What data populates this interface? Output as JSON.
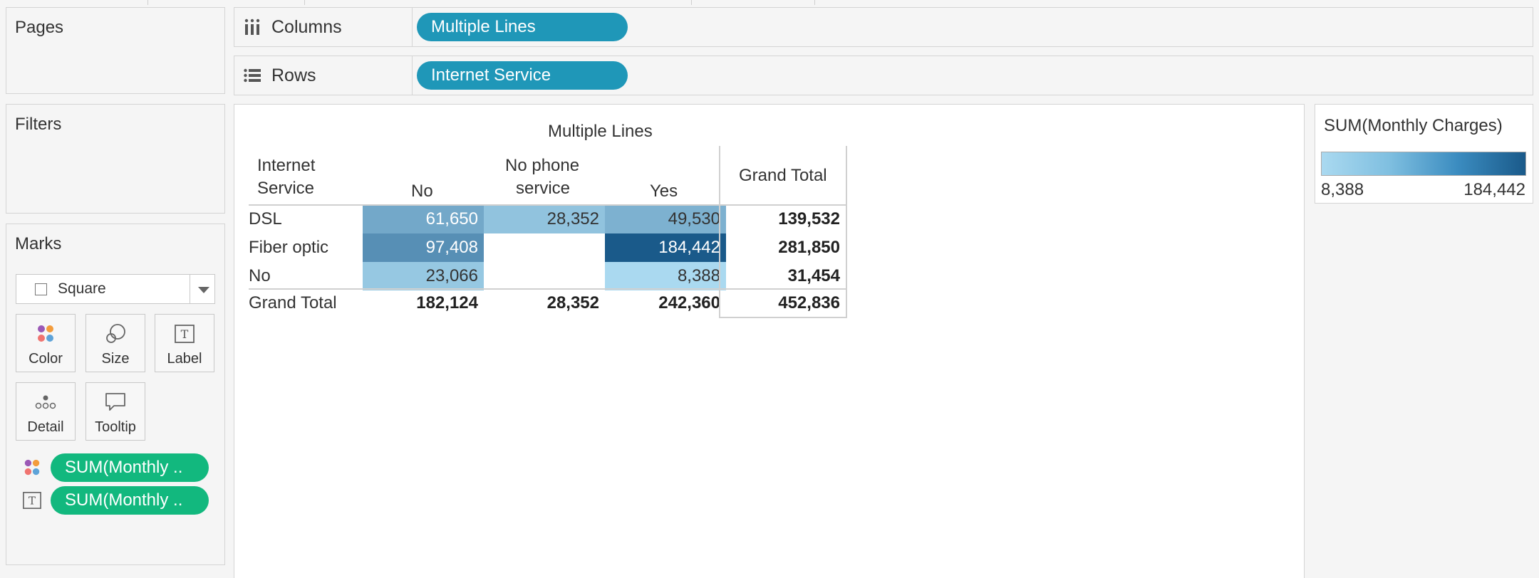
{
  "shelves": {
    "pages_title": "Pages",
    "filters_title": "Filters",
    "columns_label": "Columns",
    "columns_pill": "Multiple Lines",
    "rows_label": "Rows",
    "rows_pill": "Internet Service"
  },
  "marks": {
    "title": "Marks",
    "mark_type": "Square",
    "buttons": {
      "color": "Color",
      "size": "Size",
      "label": "Label",
      "detail": "Detail",
      "tooltip": "Tooltip"
    },
    "fields": [
      {
        "icon": "color-dots-icon",
        "label": "SUM(Monthly .."
      },
      {
        "icon": "text-label-icon",
        "label": "SUM(Monthly .."
      }
    ]
  },
  "table": {
    "column_header_title": "Multiple Lines",
    "row_header": {
      "line1": "Internet",
      "line2": "Service"
    },
    "columns": [
      {
        "line1": "",
        "line2": "No"
      },
      {
        "line1": "No phone",
        "line2": "service"
      },
      {
        "line1": "",
        "line2": "Yes"
      }
    ],
    "grand_total_label": "Grand Total",
    "rows": [
      {
        "label": "DSL",
        "values": [
          "61,650",
          "28,352",
          "49,530"
        ],
        "total": "139,532"
      },
      {
        "label": "Fiber optic",
        "values": [
          "97,408",
          "",
          "184,442"
        ],
        "total": "281,850"
      },
      {
        "label": "No",
        "values": [
          "23,066",
          "",
          "8,388"
        ],
        "total": "31,454"
      }
    ],
    "grand_total_row": {
      "label": "Grand Total",
      "values": [
        "182,124",
        "28,352",
        "242,360"
      ],
      "total": "452,836"
    }
  },
  "chart_data": {
    "type": "heatmap",
    "title": "Multiple Lines",
    "x": [
      "No",
      "No phone service",
      "Yes"
    ],
    "y": [
      "DSL",
      "Fiber optic",
      "No"
    ],
    "xlabel": "Multiple Lines",
    "ylabel": "Internet Service",
    "values": [
      [
        61650,
        28352,
        49530
      ],
      [
        97408,
        null,
        184442
      ],
      [
        23066,
        null,
        8388
      ]
    ],
    "row_totals": [
      139532,
      281850,
      31454
    ],
    "column_totals": [
      182124,
      28352,
      242360
    ],
    "grand_total": 452836,
    "color_scale": {
      "min": 8388,
      "max": 184442,
      "colors": [
        "#aad9f0",
        "#1a5a8a"
      ]
    }
  },
  "legend": {
    "title": "SUM(Monthly Charges)",
    "min_label": "8,388",
    "max_label": "184,442"
  },
  "colors": {
    "shelf_pill": "#1f97b8",
    "field_pill": "#12b87e"
  }
}
